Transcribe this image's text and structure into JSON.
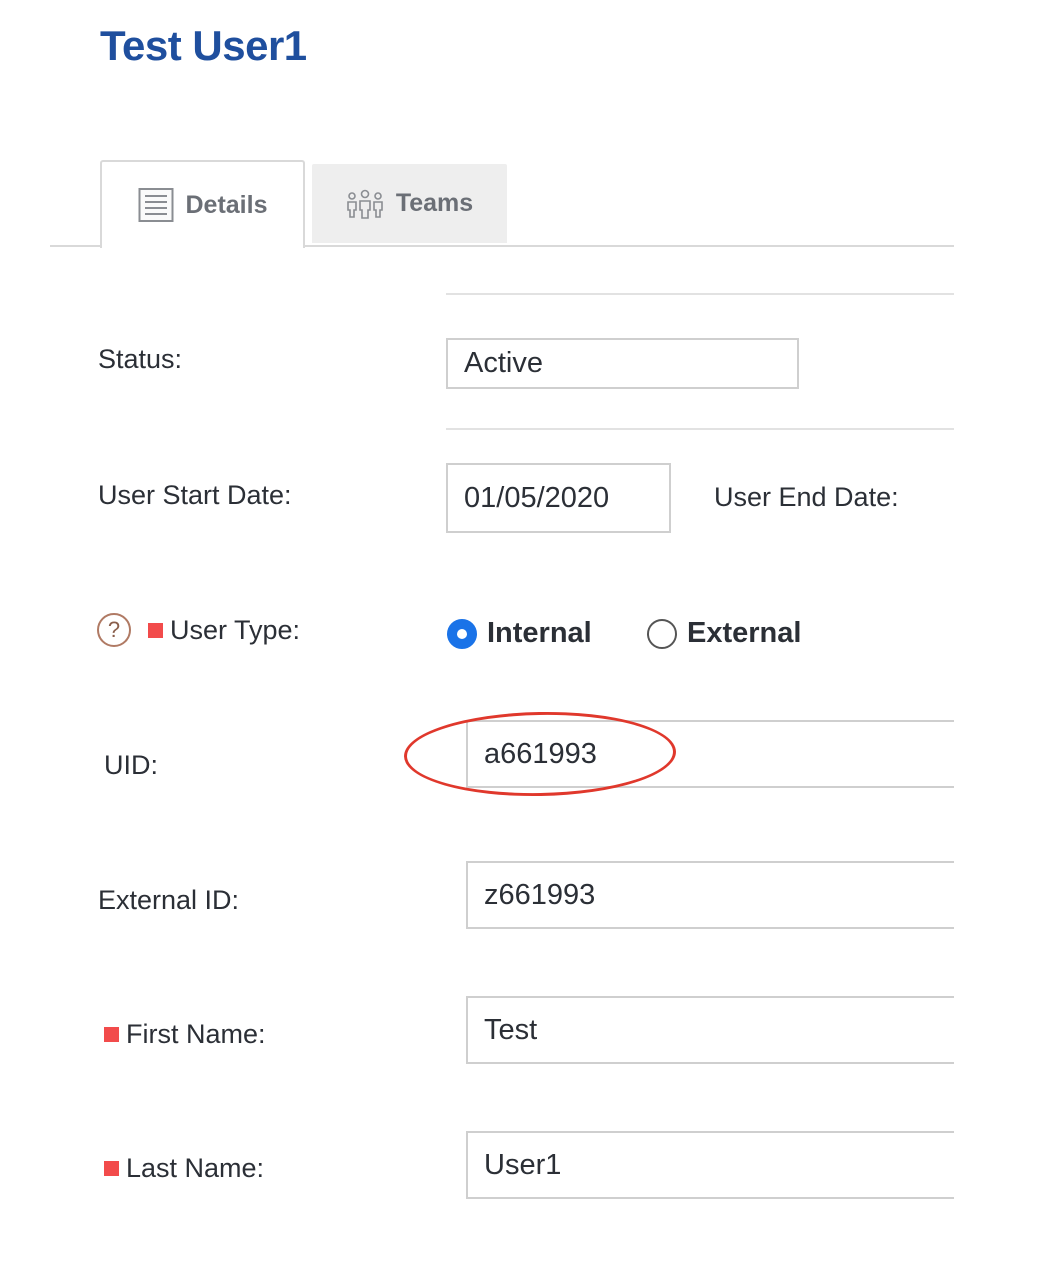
{
  "page": {
    "title": "Test User1"
  },
  "tabs": [
    {
      "label": "Details",
      "icon": "document-icon",
      "active": true
    },
    {
      "label": "Teams",
      "icon": "users-group-icon",
      "active": false
    }
  ],
  "form": {
    "status": {
      "label": "Status:",
      "value": "Active"
    },
    "start_date": {
      "label": "User Start Date:",
      "value": "01/05/2020"
    },
    "end_date": {
      "label": "User End Date:"
    },
    "user_type": {
      "label": "User Type:",
      "required": true,
      "options": [
        {
          "label": "Internal",
          "selected": true
        },
        {
          "label": "External",
          "selected": false
        }
      ]
    },
    "uid": {
      "label": "UID:",
      "value": "a661993"
    },
    "external_id": {
      "label": "External ID:",
      "value": "z661993"
    },
    "first_name": {
      "label": "First Name:",
      "value": "Test",
      "required": true
    },
    "last_name": {
      "label": "Last Name:",
      "value": "User1",
      "required": true
    }
  },
  "colors": {
    "title": "#1f4f9e",
    "required_marker": "#f24b4b",
    "radio_selected": "#1a73e8",
    "annotation": "#e0382c"
  }
}
